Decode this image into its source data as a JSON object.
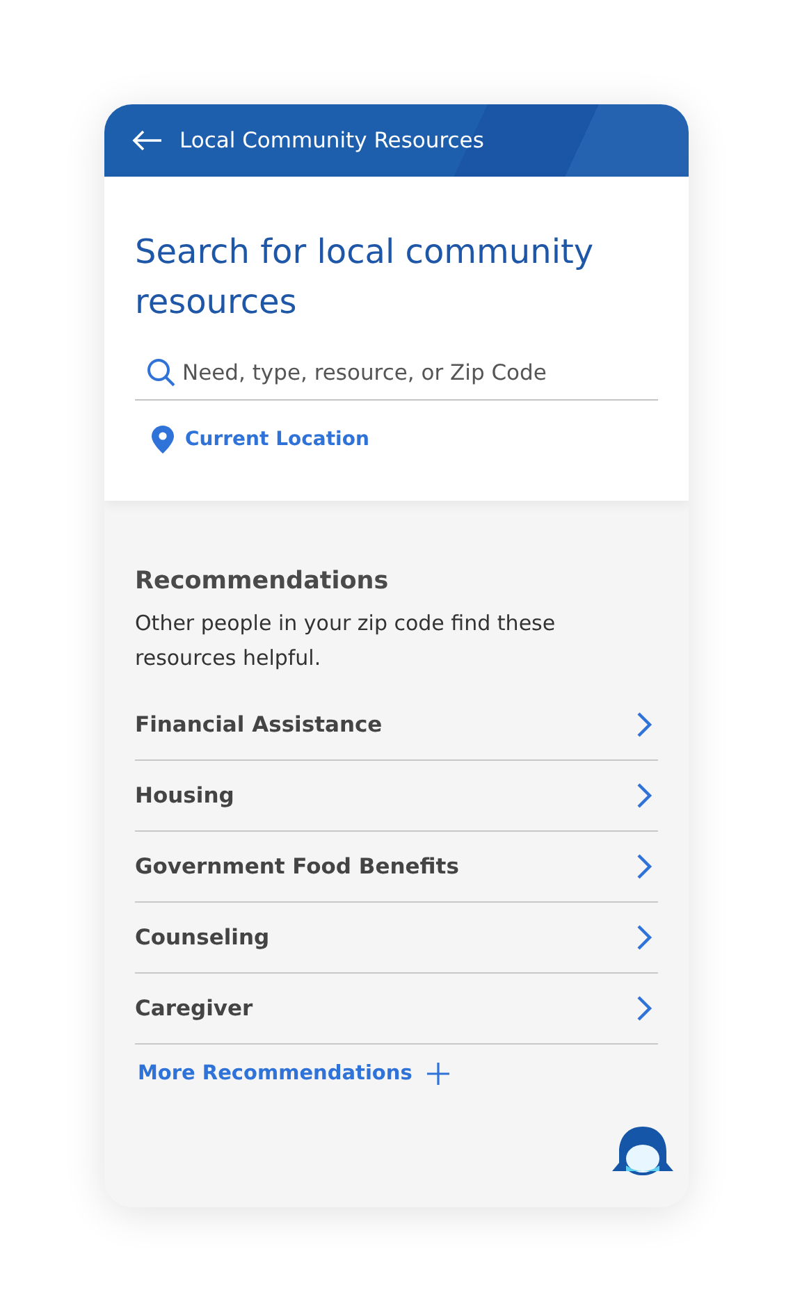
{
  "header": {
    "title": "Local Community Resources"
  },
  "search": {
    "heading": "Search for local community resources",
    "placeholder": "Need, type, resource, or Zip Code",
    "location_link": "Current Location"
  },
  "recommendations": {
    "title": "Recommendations",
    "description": "Other people in your zip code find these resources helpful.",
    "items": [
      {
        "label": "Financial Assistance"
      },
      {
        "label": "Housing"
      },
      {
        "label": "Government Food Benefits"
      },
      {
        "label": "Counseling"
      },
      {
        "label": "Caregiver"
      }
    ],
    "more_link": "More Recommendations"
  }
}
